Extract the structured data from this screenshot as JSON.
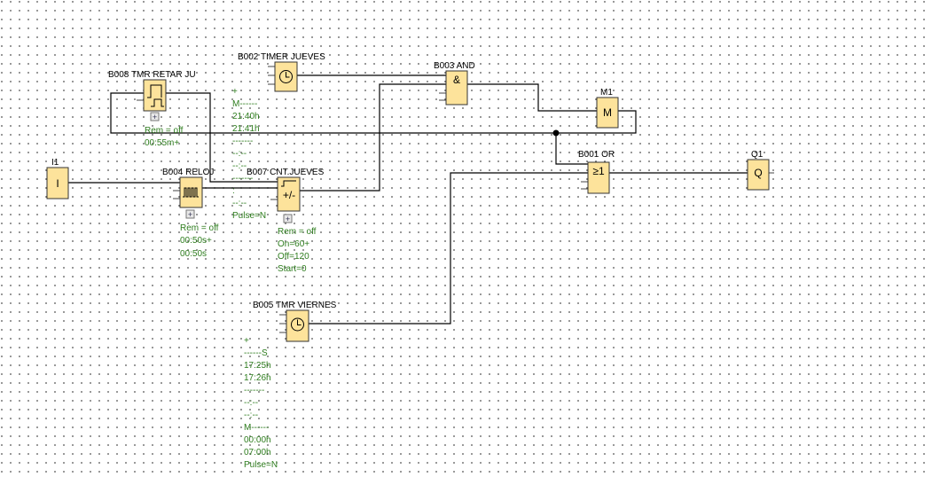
{
  "colors": {
    "block": "#fde39b",
    "params": "#2e7d1e",
    "wire": "#000000"
  },
  "blocks": {
    "i1": {
      "label": "I1",
      "symbol": "I"
    },
    "b008": {
      "label": "B008 TMR RETAR JU",
      "params": [
        "Rem = off",
        "00:55m+"
      ]
    },
    "b002": {
      "label": "B002 TIMER JUEVES",
      "params": [
        "+",
        "M------",
        "21:40h",
        "21:41h",
        "-------",
        "--:--",
        "--:--",
        "-------",
        ":",
        "--:--",
        "Pulse=N"
      ]
    },
    "b004": {
      "label": "B004 RELOJ",
      "params": [
        "Rem = off",
        "00:50s+",
        "00:50s"
      ]
    },
    "b007": {
      "label": "B007 CNT.JUEVES",
      "symbol": "+/-",
      "params": [
        "Rem = off",
        "On=60+",
        "Off=120",
        "Start=0"
      ]
    },
    "b003": {
      "label": "B003 AND",
      "symbol": "&"
    },
    "m1": {
      "label": "M1",
      "symbol": "M"
    },
    "b001": {
      "label": "B001 OR",
      "symbol": "≥1"
    },
    "q1": {
      "label": "Q1",
      "symbol": "Q"
    },
    "b005": {
      "label": "B005 TMR VIERNES",
      "params": [
        "+",
        "------S",
        "17:25h",
        "17:26h",
        "-------",
        "--:--",
        "--:--",
        "M------",
        "00:00h",
        "07:00h",
        "Pulse=N"
      ]
    }
  }
}
